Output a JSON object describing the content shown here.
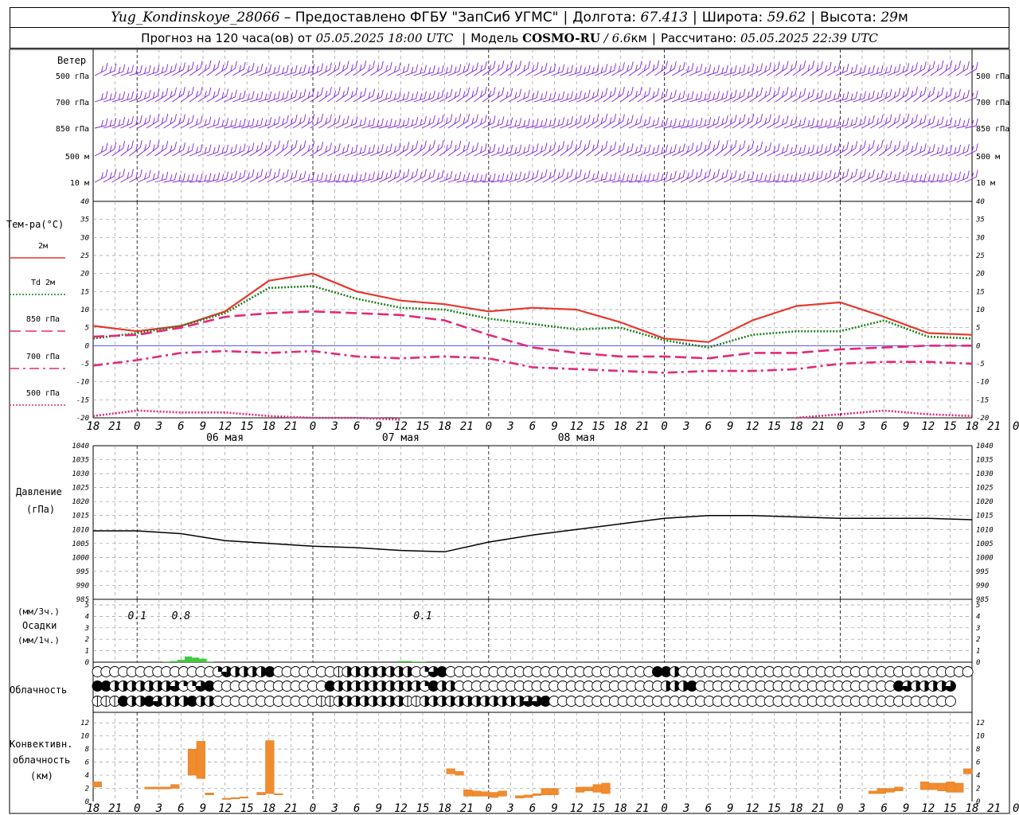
{
  "header": {
    "station": "Yug_Kondinskoye_28066",
    "provided": "– Предоставлено ФГБУ \"ЗапСиб УГМС\"",
    "lon_label": "Долгота:",
    "lon_value": "67.413",
    "lat_label": "Широта:",
    "lat_value": "59.62",
    "alt_label": "Высота:",
    "alt_value": "29",
    "alt_unit": "м",
    "forecast_prefix": "Прогноз на 120 часа(ов) от",
    "forecast_time": "05.05.2025 18:00 UTC",
    "model_label": "Модель",
    "model_name": "COSMO-RU",
    "model_res": "/ 6.6",
    "model_res_unit": "км",
    "calc_label": "Рассчитано:",
    "calc_time": "05.05.2025 22:39 UTC"
  },
  "chart_data": [
    {
      "type": "wind-barbs",
      "title": "Ветер",
      "levels": [
        "500 гПа",
        "700 гПа",
        "850 гПа",
        "500 м",
        "10 м"
      ],
      "color": "#7b1fd6"
    },
    {
      "type": "line",
      "ylabel": "Тем-ра(°C)",
      "ylim": [
        -20,
        40
      ],
      "yticks": [
        -20,
        -15,
        -10,
        -5,
        0,
        5,
        10,
        15,
        20,
        25,
        30,
        35,
        40
      ],
      "x": [
        0,
        6,
        12,
        18,
        24,
        30,
        36,
        42,
        48,
        54,
        60,
        66,
        72,
        78,
        84,
        90,
        96,
        102,
        108,
        114,
        120
      ],
      "series": [
        {
          "name": "2м",
          "color": "#e8372c",
          "style": "solid",
          "values": [
            5.5,
            4,
            5.5,
            9.5,
            18,
            20,
            15,
            12.5,
            11.5,
            9.5,
            10.5,
            10,
            6.5,
            2,
            1,
            7,
            11,
            12,
            8,
            3.5,
            3
          ]
        },
        {
          "name": "Td 2м",
          "color": "#1e7f1e",
          "style": "dotted",
          "values": [
            2,
            3.5,
            5.5,
            9,
            16,
            16.5,
            13,
            10.5,
            10,
            7.5,
            6,
            4.5,
            5,
            1.5,
            -0.5,
            3,
            4,
            4,
            7,
            2.5,
            2
          ]
        },
        {
          "name": "850 гПа",
          "color": "#e4287c",
          "style": "dashed",
          "values": [
            2.5,
            3,
            5,
            8,
            9,
            9.5,
            9,
            8.5,
            7,
            3,
            -0.5,
            -2,
            -3,
            -3,
            -3.5,
            -2,
            -2,
            -1,
            -0.5,
            0,
            0
          ]
        },
        {
          "name": "700 гПа",
          "color": "#e4287c",
          "style": "dashdot",
          "values": [
            -5.5,
            -4,
            -2,
            -1.5,
            -2,
            -1.5,
            -3,
            -3.5,
            -3,
            -3.5,
            -6,
            -6.5,
            -7,
            -7.5,
            -7,
            -7,
            -6.5,
            -5,
            -4.5,
            -4.5,
            -5
          ]
        },
        {
          "name": "500 гПа",
          "color": "#e4287c",
          "style": "dotted",
          "values": [
            -19.5,
            -18,
            -18.5,
            -18.5,
            -19.5,
            -20,
            -20,
            -20.5,
            null,
            null,
            null,
            null,
            null,
            null,
            null,
            null,
            -20,
            -19,
            -18,
            -19,
            -19.5
          ]
        }
      ]
    },
    {
      "type": "line",
      "ylabel": "Давление",
      "yunit": "(гПа)",
      "ylim": [
        985,
        1040
      ],
      "yticks": [
        985,
        990,
        995,
        1000,
        1005,
        1010,
        1015,
        1020,
        1025,
        1030,
        1035,
        1040
      ],
      "x": [
        0,
        6,
        12,
        18,
        24,
        30,
        36,
        42,
        48,
        54,
        60,
        66,
        72,
        78,
        84,
        90,
        96,
        102,
        108,
        114,
        120
      ],
      "series": [
        {
          "name": "",
          "color": "#000000",
          "values": [
            1009.5,
            1009.5,
            1008.5,
            1006,
            1005,
            1004,
            1003.5,
            1002.5,
            1002,
            1005.5,
            1008,
            1010,
            1012,
            1014,
            1015,
            1015,
            1014.5,
            1014,
            1014,
            1014,
            1013.5
          ]
        }
      ]
    },
    {
      "type": "bar",
      "ylabel": "Осадки",
      "yunit_3h": "(мм/3ч.)",
      "yunit_1h": "(мм/1ч.)",
      "ylim": [
        0,
        5
      ],
      "yticks": [
        0,
        1,
        2,
        3,
        4,
        5
      ],
      "color": "#3ec93e",
      "x": [
        10,
        11,
        12,
        13,
        14,
        15,
        16,
        42,
        43,
        44,
        45
      ],
      "values": [
        0.05,
        0.1,
        0.2,
        0.5,
        0.4,
        0.3,
        0.05,
        0.1,
        0.1,
        0.05,
        0.05
      ],
      "annotations": [
        {
          "x": 6,
          "text": "0.1"
        },
        {
          "x": 12,
          "text": "0.8"
        },
        {
          "x": 45,
          "text": "0.1"
        }
      ]
    },
    {
      "type": "cloud-cover",
      "ylabel": "Облачность",
      "rows": [
        "oooooooooooooopQhhhhHoooooooFhhhhhhhhopQHooooooooooooooooooooooooHHhoooooooooooooooooooooooooooooooooo",
        "HHhhhhhhhQppQHoooooooooooooHhhhhhhhhhhpHhhoooooooooooooooooooooooohhhHoooooooooooooooooooooooHQhhhhQ",
        "FFFHhhHQhhhHhhooooooooooooFFhhhhhhhhFFhhhhhhhhhhhhQQHooooooooooooooooooooooooooooooooooooooooooooooo"
      ]
    },
    {
      "type": "bar",
      "ylabel": "Конвективн. облачность",
      "yunit": "(км)",
      "ylim": [
        0,
        13
      ],
      "yticks": [
        0,
        2,
        4,
        6,
        8,
        10,
        12
      ],
      "color": "#f08b2e",
      "bars": [
        {
          "x": 0,
          "base": 2.2,
          "top": 3
        },
        {
          "x": 6,
          "base": 1.9,
          "top": 2.2
        },
        {
          "x": 7,
          "base": 1.9,
          "top": 2.2
        },
        {
          "x": 8,
          "base": 1.9,
          "top": 2.2
        },
        {
          "x": 9,
          "base": 2,
          "top": 2.6
        },
        {
          "x": 11,
          "base": 4,
          "top": 8
        },
        {
          "x": 12,
          "base": 3.5,
          "top": 9.2
        },
        {
          "x": 13,
          "base": 1,
          "top": 1.3
        },
        {
          "x": 15,
          "base": 0.3,
          "top": 0.5
        },
        {
          "x": 16,
          "base": 0.4,
          "top": 0.6
        },
        {
          "x": 17,
          "base": 0.5,
          "top": 0.7
        },
        {
          "x": 19,
          "base": 1,
          "top": 1.4
        },
        {
          "x": 20,
          "base": 1.2,
          "top": 9.3
        },
        {
          "x": 21,
          "base": 1,
          "top": 1.2
        },
        {
          "x": 41,
          "base": 4.2,
          "top": 5
        },
        {
          "x": 42,
          "base": 4,
          "top": 4.6
        },
        {
          "x": 43,
          "base": 0.8,
          "top": 1.8
        },
        {
          "x": 44,
          "base": 0.8,
          "top": 1.6
        },
        {
          "x": 45,
          "base": 0.8,
          "top": 1.5
        },
        {
          "x": 46,
          "base": 0.6,
          "top": 1.4
        },
        {
          "x": 47,
          "base": 0.8,
          "top": 1.6
        },
        {
          "x": 49,
          "base": 0.5,
          "top": 0.9
        },
        {
          "x": 50,
          "base": 0.6,
          "top": 1
        },
        {
          "x": 51,
          "base": 0.9,
          "top": 1.2
        },
        {
          "x": 52,
          "base": 1,
          "top": 2
        },
        {
          "x": 53,
          "base": 1,
          "top": 2
        },
        {
          "x": 56,
          "base": 1.4,
          "top": 2.2
        },
        {
          "x": 57,
          "base": 1.6,
          "top": 2.2
        },
        {
          "x": 58,
          "base": 1.4,
          "top": 2.6
        },
        {
          "x": 59,
          "base": 1.2,
          "top": 2.8
        },
        {
          "x": 90,
          "base": 1.2,
          "top": 1.6
        },
        {
          "x": 91,
          "base": 1.2,
          "top": 2
        },
        {
          "x": 92,
          "base": 1.4,
          "top": 2
        },
        {
          "x": 93,
          "base": 1.6,
          "top": 2.2
        },
        {
          "x": 96,
          "base": 1.8,
          "top": 3
        },
        {
          "x": 97,
          "base": 1.8,
          "top": 2.8
        },
        {
          "x": 98,
          "base": 1.6,
          "top": 2.8
        },
        {
          "x": 99,
          "base": 1.4,
          "top": 3
        },
        {
          "x": 100,
          "base": 1.4,
          "top": 2.8
        },
        {
          "x": 101,
          "base": 4.2,
          "top": 5
        }
      ]
    }
  ],
  "time_axis": {
    "tick_labels": [
      "18",
      "21",
      "0",
      "3",
      "6",
      "9",
      "12",
      "15",
      "18",
      "21",
      "0",
      "3",
      "6",
      "9",
      "12",
      "15",
      "18",
      "21",
      "0",
      "3",
      "6",
      "9",
      "12",
      "15",
      "18",
      "21",
      "0",
      "3",
      "6",
      "9",
      "12",
      "15",
      "18",
      "21",
      "0",
      "3",
      "6",
      "9",
      "12",
      "15",
      "18",
      "21",
      "0"
    ],
    "day_labels": [
      "06 мая",
      "07 мая",
      "08 мая"
    ]
  },
  "colors": {
    "grid": "#9a9a9a",
    "wind": "#7b1fd6",
    "zero_line": "#3a3ae0"
  }
}
